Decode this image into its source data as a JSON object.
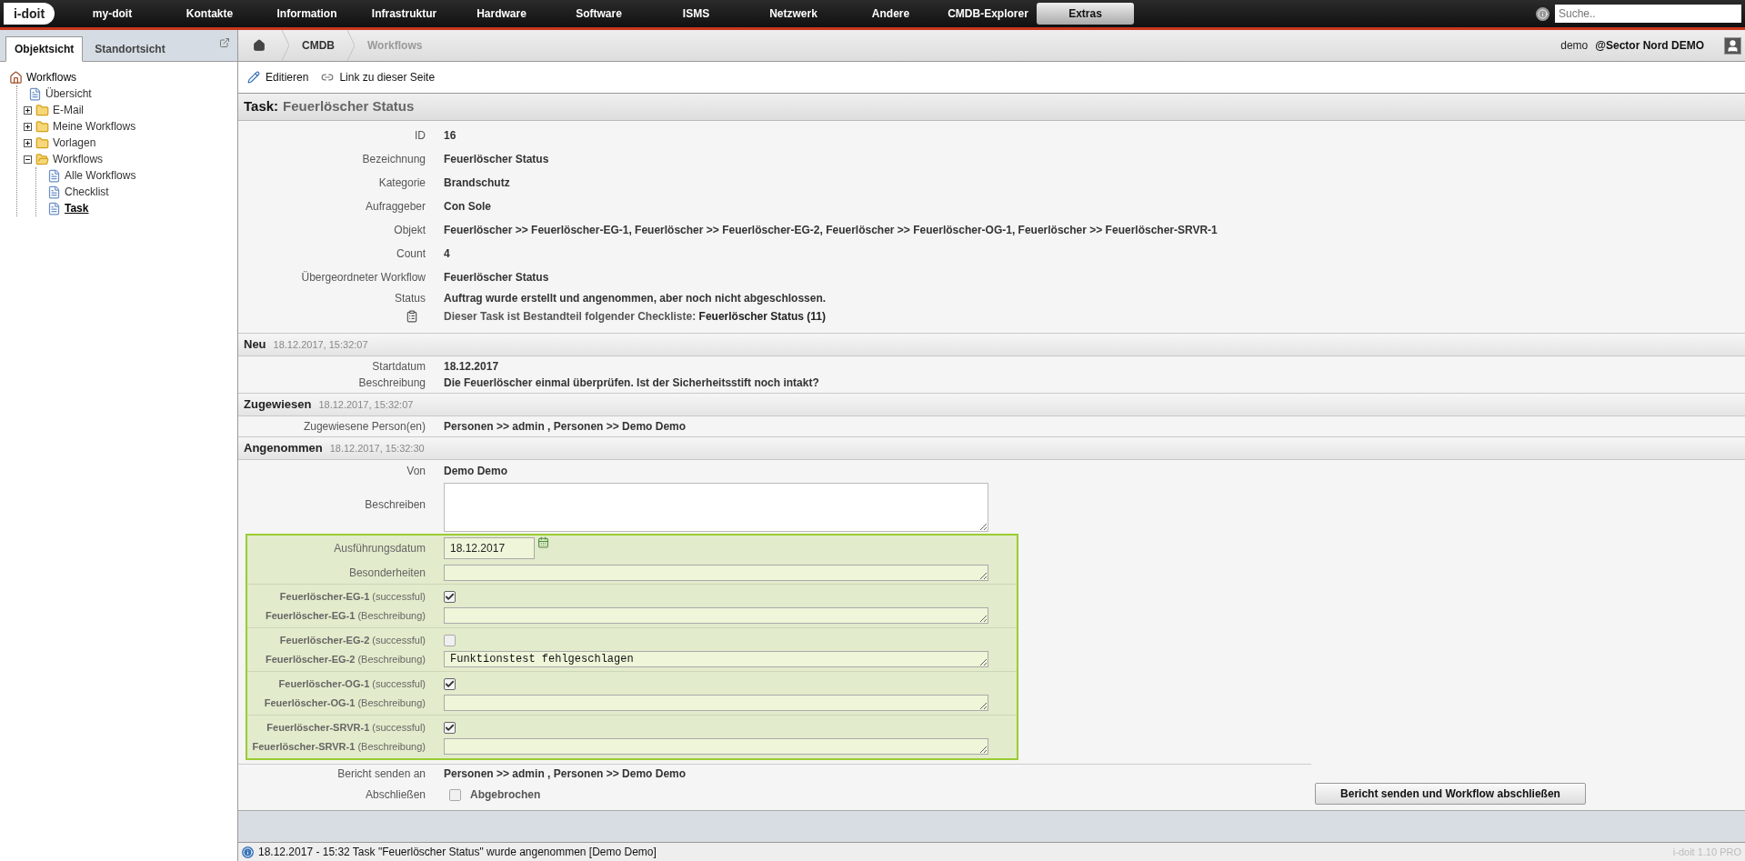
{
  "logo": "i-doit",
  "nav": [
    {
      "label": "my-doit",
      "selected": false
    },
    {
      "label": "Kontakte",
      "selected": false
    },
    {
      "label": "Information",
      "selected": false
    },
    {
      "label": "Infrastruktur",
      "selected": false
    },
    {
      "label": "Hardware",
      "selected": false
    },
    {
      "label": "Software",
      "selected": false
    },
    {
      "label": "ISMS",
      "selected": false
    },
    {
      "label": "Netzwerk",
      "selected": false
    },
    {
      "label": "Andere",
      "selected": false
    },
    {
      "label": "CMDB-Explorer",
      "selected": false
    },
    {
      "label": "Extras",
      "selected": true
    }
  ],
  "search": {
    "placeholder": "Suche.."
  },
  "sidebar": {
    "tabs": [
      {
        "label": "Objektsicht",
        "selected": true
      },
      {
        "label": "Standortsicht",
        "selected": false
      }
    ],
    "tree": [
      {
        "label": "Workflows",
        "kind": "home",
        "selected": false,
        "children": [
          {
            "label": "Übersicht",
            "kind": "page",
            "selected": false
          },
          {
            "label": "E-Mail",
            "kind": "folder",
            "expanded": false,
            "selected": false
          },
          {
            "label": "Meine Workflows",
            "kind": "folder",
            "expanded": false,
            "selected": false
          },
          {
            "label": "Vorlagen",
            "kind": "folder",
            "expanded": false,
            "selected": false
          },
          {
            "label": "Workflows",
            "kind": "folder",
            "expanded": true,
            "selected": false,
            "children": [
              {
                "label": "Alle Workflows",
                "kind": "page",
                "selected": false
              },
              {
                "label": "Checklist",
                "kind": "page",
                "selected": false
              },
              {
                "label": "Task",
                "kind": "page",
                "selected": true
              }
            ]
          }
        ]
      }
    ]
  },
  "breadcrumb": [
    {
      "label": "CMDB",
      "selected": false
    },
    {
      "label": "Workflows",
      "selected": true
    }
  ],
  "user": {
    "name": "demo",
    "tenant": "@Sector Nord DEMO"
  },
  "toolbar": [
    "Editieren",
    "Link zu dieser Seite"
  ],
  "title": {
    "prefix": "Task:",
    "name": "Feuerlöscher Status"
  },
  "details": [
    {
      "label": "ID",
      "value": "16"
    },
    {
      "label": "Bezeichnung",
      "value": "Feuerlöscher Status"
    },
    {
      "label": "Kategorie",
      "value": "Brandschutz"
    },
    {
      "label": "Aufraggeber",
      "value": "Con Sole"
    },
    {
      "label": "Objekt",
      "value": "Feuerlöscher >> Feuerlöscher-EG-1, Feuerlöscher >> Feuerlöscher-EG-2, Feuerlöscher >> Feuerlöscher-OG-1, Feuerlöscher >> Feuerlöscher-SRVR-1"
    },
    {
      "label": "Count",
      "value": "4"
    },
    {
      "label": "Übergeordneter Workflow",
      "value": "Feuerlöscher Status"
    }
  ],
  "status": {
    "label": "Status",
    "value": "Auftrag wurde erstellt und angenommen, aber noch nicht abgeschlossen."
  },
  "checklist": {
    "text": "Dieser Task ist Bestandteil folgender Checkliste:",
    "link": "Feuerlöscher Status (11)"
  },
  "sections": [
    {
      "title": "Neu",
      "time": "18.12.2017, 15:32:07",
      "fields": [
        {
          "label": "Startdatum",
          "value": "18.12.2017"
        },
        {
          "label": "Beschreibung",
          "value": "Die Feuerlöscher einmal überprüfen. Ist der Sicherheitsstift noch intakt?"
        }
      ]
    },
    {
      "title": "Zugewiesen",
      "time": "18.12.2017, 15:32:07",
      "fields": [
        {
          "label": "Zugewiesene Person(en)",
          "value": "Personen >> admin , Personen >> Demo Demo"
        }
      ]
    }
  ],
  "accepted": {
    "title": "Angenommen",
    "time": "18.12.2017, 15:32:30",
    "from": {
      "label": "Von",
      "value": "Demo Demo"
    },
    "describe_label": "Beschreiben",
    "date": {
      "label": "Ausführungsdatum",
      "value": "18.12.2017"
    },
    "notes_label": "Besonderheiten",
    "checks": [
      {
        "label": "**Feuerlöscher-EG-1** (successful)",
        "checked": true,
        "desc_label": "**Feuerlöscher-EG-1** (Beschreibung)"
      },
      {
        "label": "**Feuerlöscher-EG-2** (successful)",
        "checked": false,
        "desc_label": "**Feuerlöscher-EG-2** (Beschreibung)",
        "desc_value": "Funktionstest fehlgeschlagen"
      },
      {
        "label": "**Feuerlöscher-OG-1** (successful)",
        "checked": true,
        "desc_label": "**Feuerlöscher-OG-1** (Beschreibung)"
      },
      {
        "label": "**Feuerlöscher-SRVR-1** (successful)",
        "checked": true,
        "desc_label": "**Feuerlöscher-SRVR-1** (Beschreibung)"
      }
    ],
    "report": {
      "label": "Bericht senden an",
      "value": "Personen >> admin , Personen >> Demo Demo"
    },
    "close": {
      "label": "Abschließen",
      "option": "Abgebrochen",
      "checked": false
    },
    "button": "Bericht senden und Workflow abschließen"
  },
  "status_bar": {
    "message": "18.12.2017 - 15:32 Task \"Feuerlöscher Status\" wurde angenommen [Demo Demo]",
    "version": "i-doit 1.10 PRO"
  }
}
